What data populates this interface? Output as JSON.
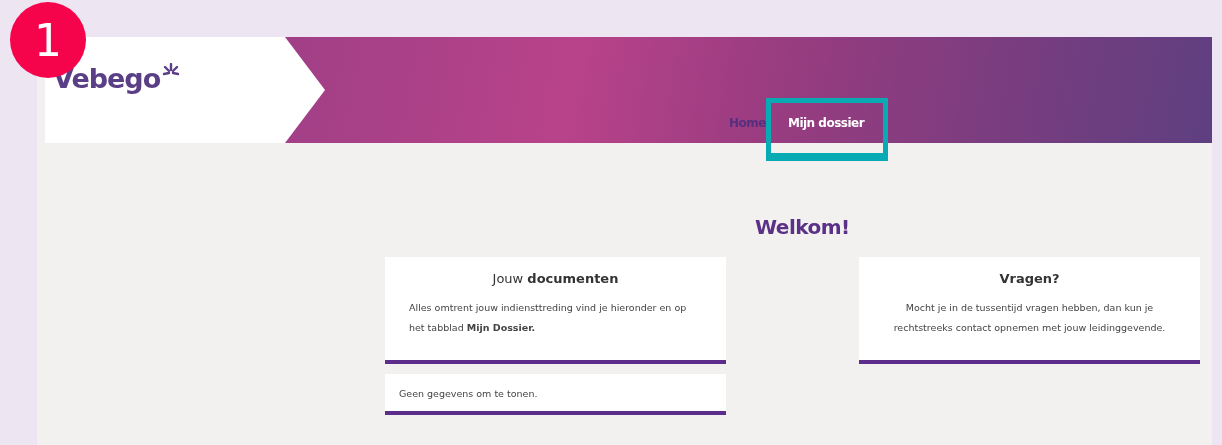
{
  "step_badge": "1",
  "header": {
    "logo": "Vebego",
    "nav": [
      {
        "label": "Home",
        "selected": false,
        "highlighted": false
      },
      {
        "label": "Mijn dossier",
        "selected": true,
        "highlighted": true
      }
    ]
  },
  "welcome": "Welkom!",
  "cards": [
    {
      "title": "Jouw **documenten**",
      "body": "Alles omtrent jouw indiensttreding vind je hieronder en op het tabblad **Mijn Dossier.**",
      "kind": "documents",
      "footer": "Geen gegevens om te tonen."
    },
    {
      "title": "**Vragen?**",
      "body": "Mocht je in de tussentijd vragen hebben, dan kun je rechtstreeks contact opnemen met jouw leidinggevende.",
      "kind": "contact"
    }
  ]
}
